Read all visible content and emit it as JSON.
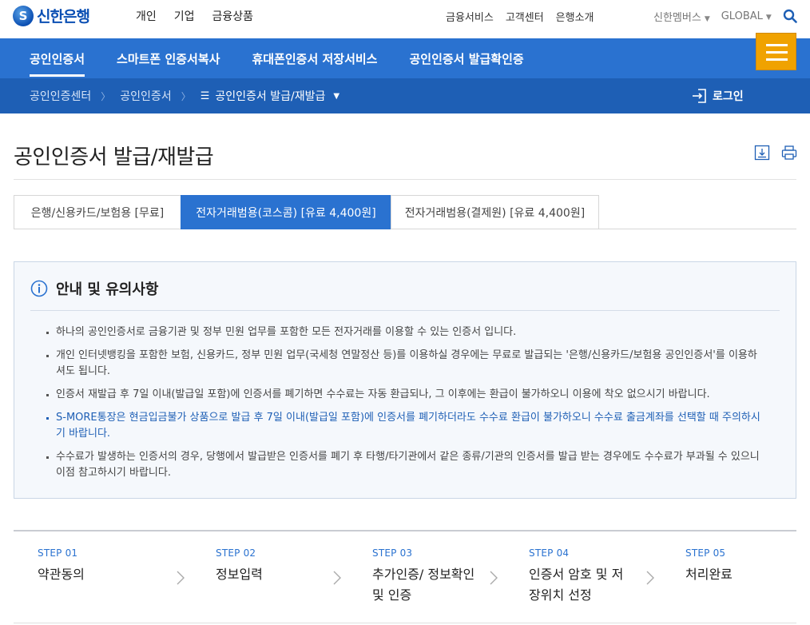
{
  "brand": {
    "logo_text": "신한은행",
    "accent": "#2a72d0",
    "menu_color": "#f0a200"
  },
  "topnav": {
    "left": [
      "개인",
      "기업",
      "금융상품"
    ],
    "right": [
      "금융서비스",
      "고객센터",
      "은행소개"
    ],
    "util": [
      "신한멤버스",
      "GLOBAL"
    ]
  },
  "mainnav": [
    "공인인증서",
    "스마트폰 인증서복사",
    "휴대폰인증서 저장서비스",
    "공인인증서 발급확인증"
  ],
  "breadcrumb": [
    "공인인증센터",
    "공인인증서",
    "공인인증서 발급/재발급"
  ],
  "login_label": "로그인",
  "page_title": "공인인증서 발급/재발급",
  "tabs": [
    {
      "label": "은행/신용카드/보험용 [무료]",
      "active": false
    },
    {
      "label": "전자거래범용(코스콤) [유료 4,400원]",
      "active": true
    },
    {
      "label": "전자거래범용(결제원) [유료 4,400원]",
      "active": false
    }
  ],
  "notice": {
    "title": "안내 및 유의사항",
    "items": [
      {
        "text": "하나의 공인인증서로 금융기관 및 정부 민원 업무를 포함한 모든 전자거래를 이용할 수 있는 인증서 입니다.",
        "highlight": false
      },
      {
        "text": "개인 인터넷뱅킹을 포함한 보험, 신용카드, 정부 민원 업무(국세청 연말정산 등)를 이용하실 경우에는 무료로 발급되는 '은행/신용카드/보험용 공인인증서'를 이용하셔도 됩니다.",
        "highlight": false
      },
      {
        "text": "인증서 재발급 후 7일 이내(발급일 포함)에 인증서를 폐기하면 수수료는 자동 환급되나, 그 이후에는 환급이 불가하오니 이용에 착오 없으시기 바랍니다.",
        "highlight": false
      },
      {
        "text": "S-MORE통장은 현금입금불가 상품으로 발급 후 7일 이내(발급일 포함)에 인증서를 폐기하더라도 수수료 환급이 불가하오니 수수료 출금계좌를 선택할 때 주의하시기 바랍니다.",
        "highlight": true
      },
      {
        "text": "수수료가 발생하는 인증서의 경우, 당행에서 발급받은 인증서를 폐기 후 타행/타기관에서 같은 종류/기관의 인증서를 발급 받는 경우에도 수수료가 부과될 수 있으니 이점 참고하시기 바랍니다.",
        "highlight": false
      }
    ]
  },
  "steps": [
    {
      "num": "STEP 01",
      "name": "약관동의"
    },
    {
      "num": "STEP 02",
      "name": "정보입력"
    },
    {
      "num": "STEP 03",
      "name": "추가인증/ 정보확인 및 인증"
    },
    {
      "num": "STEP 04",
      "name": "인증서 암호 및 저장위치 선정"
    },
    {
      "num": "STEP 05",
      "name": "처리완료"
    }
  ]
}
